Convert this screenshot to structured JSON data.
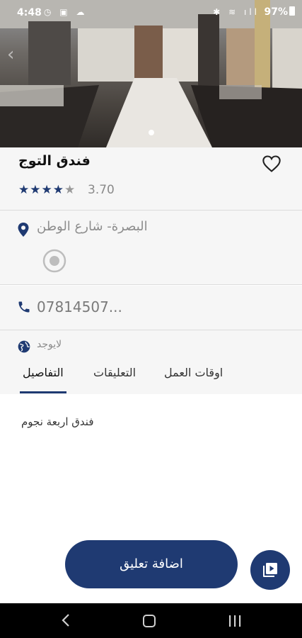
{
  "status_bar": {
    "time": "4:48",
    "left_icons": "◷ ▣ ☁",
    "right_icons": "✱ ≋ ıll",
    "battery": "97%"
  },
  "place": {
    "name": "فندق التوج",
    "rating": "3.70",
    "rating_value": 3.7,
    "stars_filled": 4,
    "stars_total": 5,
    "address": "البصرة- شارع الوطن",
    "phone": "07814507...",
    "website": "لايوجد",
    "description": "فندق اربعة نجوم"
  },
  "tabs": [
    {
      "label": "اوقات العمل"
    },
    {
      "label": "التعليقات"
    },
    {
      "label": "التفاصيل",
      "active": true
    }
  ],
  "buttons": {
    "add_comment": "اضافة تعليق"
  },
  "icons": {
    "favorite": "heart-outline",
    "location": "map-pin",
    "map_target": "target",
    "phone": "phone",
    "website": "globe",
    "video": "video-library"
  },
  "colors": {
    "accent": "#1f3a72",
    "section_bg": "#f6f6f6",
    "muted_text": "#8d8d8d"
  }
}
